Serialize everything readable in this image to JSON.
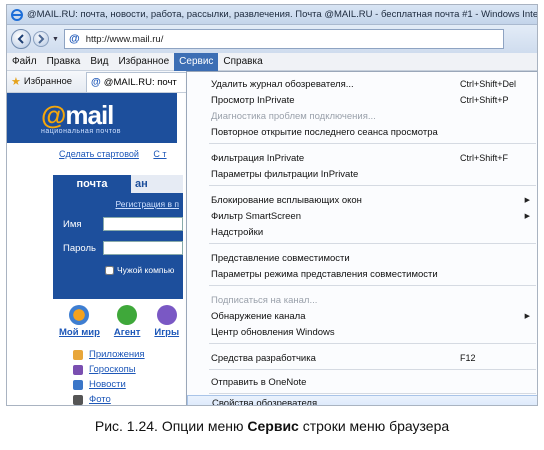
{
  "window": {
    "title": "@MAIL.RU: почта, новости, работа, рассылки, развлечения. Почта @MAIL.RU - бесплатная почта #1 - Windows Intern"
  },
  "address": {
    "url": "http://www.mail.ru/"
  },
  "menubar": {
    "items": [
      "Файл",
      "Правка",
      "Вид",
      "Избранное",
      "Сервис",
      "Справка"
    ]
  },
  "favorites": {
    "label": "Избранное",
    "tab_title": "@MAIL.RU: почт"
  },
  "page": {
    "logo": "mail",
    "slogan": "национальная почтов",
    "top_links": [
      "Сделать стартовой",
      "С т"
    ],
    "mail_tab": "почта",
    "mail_tab2": "ан",
    "register_link": "Регистрация в п",
    "login_label": "Имя",
    "password_label": "Пароль",
    "remember_label": "Чужой компью",
    "apps": [
      "Мой мир",
      "Агент",
      "Игры"
    ],
    "services": [
      "Приложения",
      "Гороскопы",
      "Новости",
      "Фото"
    ]
  },
  "dropdown": {
    "items": [
      {
        "label": "Удалить журнал обозревателя...",
        "shortcut": "Ctrl+Shift+Del"
      },
      {
        "label": "Просмотр InPrivate",
        "shortcut": "Ctrl+Shift+P"
      },
      {
        "label": "Диагностика проблем подключения..."
      },
      {
        "label": "Повторное открытие последнего сеанса просмотра"
      },
      {
        "label": "Фильтрация InPrivate",
        "shortcut": "Ctrl+Shift+F"
      },
      {
        "label": "Параметры фильтрации InPrivate"
      },
      {
        "label": "Блокирование всплывающих окон"
      },
      {
        "label": "Фильтр SmartScreen"
      },
      {
        "label": "Надстройки"
      },
      {
        "label": "Представление совместимости"
      },
      {
        "label": "Параметры режима представления совместимости"
      },
      {
        "label": "Подписаться на канал..."
      },
      {
        "label": "Обнаружение канала"
      },
      {
        "label": "Центр обновления Windows"
      },
      {
        "label": "Средства разработчика",
        "shortcut": "F12"
      },
      {
        "label": "Отправить в OneNote"
      },
      {
        "label": "Свойства обозревателя"
      }
    ]
  },
  "caption": {
    "prefix": "Рис. 1.24.",
    "text1": " Опции меню ",
    "bold": "Сервис",
    "text2": " строки меню браузера"
  }
}
